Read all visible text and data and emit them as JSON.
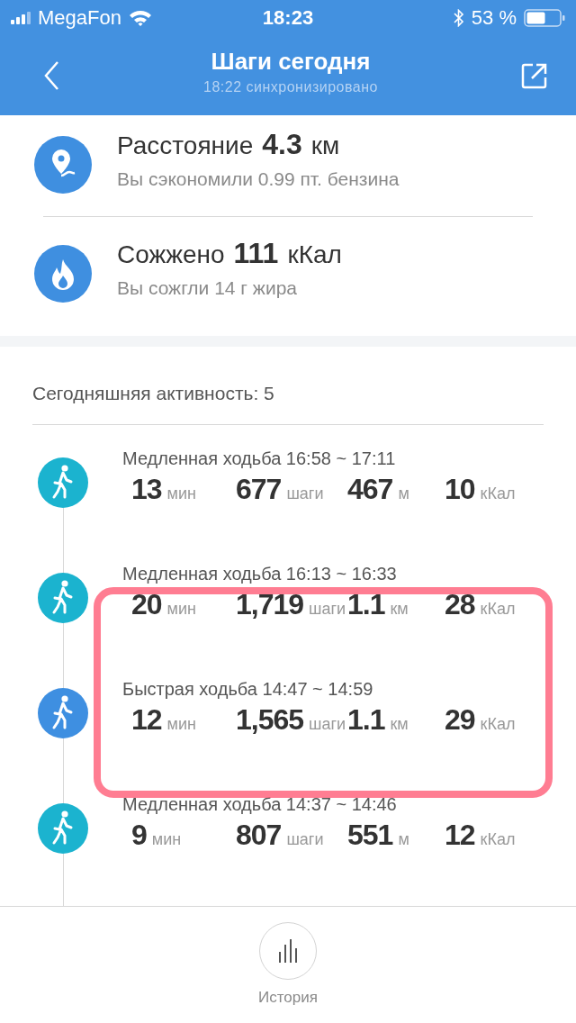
{
  "status_bar": {
    "carrier": "MegaFon",
    "time": "18:23",
    "battery": "53 %"
  },
  "nav": {
    "title": "Шаги сегодня",
    "subtitle": "18:22 синхронизировано"
  },
  "summary": [
    {
      "kind": "distance",
      "label": "Расстояние",
      "value": "4.3",
      "unit": "км",
      "note": "Вы сэкономили 0.99 пт. бензина"
    },
    {
      "kind": "calories",
      "label": "Сожжено",
      "value": "111",
      "unit": "кКал",
      "note": "Вы сожгли 14 г жира"
    }
  ],
  "activity_header": "Сегодняшняя активность: 5",
  "activities": [
    {
      "kind": "slow",
      "title": "Медленная ходьба 16:58 ~ 17:11",
      "stats": [
        {
          "value": "13",
          "unit": "мин"
        },
        {
          "value": "677",
          "unit": "шаги"
        },
        {
          "value": "467",
          "unit": "м"
        },
        {
          "value": "10",
          "unit": "кКал"
        }
      ]
    },
    {
      "kind": "slow",
      "title": "Медленная ходьба 16:13 ~ 16:33",
      "stats": [
        {
          "value": "20",
          "unit": "мин"
        },
        {
          "value": "1,719",
          "unit": "шаги"
        },
        {
          "value": "1.1",
          "unit": "км"
        },
        {
          "value": "28",
          "unit": "кКал"
        }
      ]
    },
    {
      "kind": "fast",
      "title": "Быстрая ходьба 14:47 ~ 14:59",
      "stats": [
        {
          "value": "12",
          "unit": "мин"
        },
        {
          "value": "1,565",
          "unit": "шаги"
        },
        {
          "value": "1.1",
          "unit": "км"
        },
        {
          "value": "29",
          "unit": "кКал"
        }
      ]
    },
    {
      "kind": "slow",
      "title": "Медленная ходьба 14:37 ~ 14:46",
      "stats": [
        {
          "value": "9",
          "unit": "мин"
        },
        {
          "value": "807",
          "unit": "шаги"
        },
        {
          "value": "551",
          "unit": "м"
        },
        {
          "value": "12",
          "unit": "кКал"
        }
      ]
    }
  ],
  "bottom_button": {
    "label": "История"
  },
  "annotation": {
    "frame": true
  }
}
